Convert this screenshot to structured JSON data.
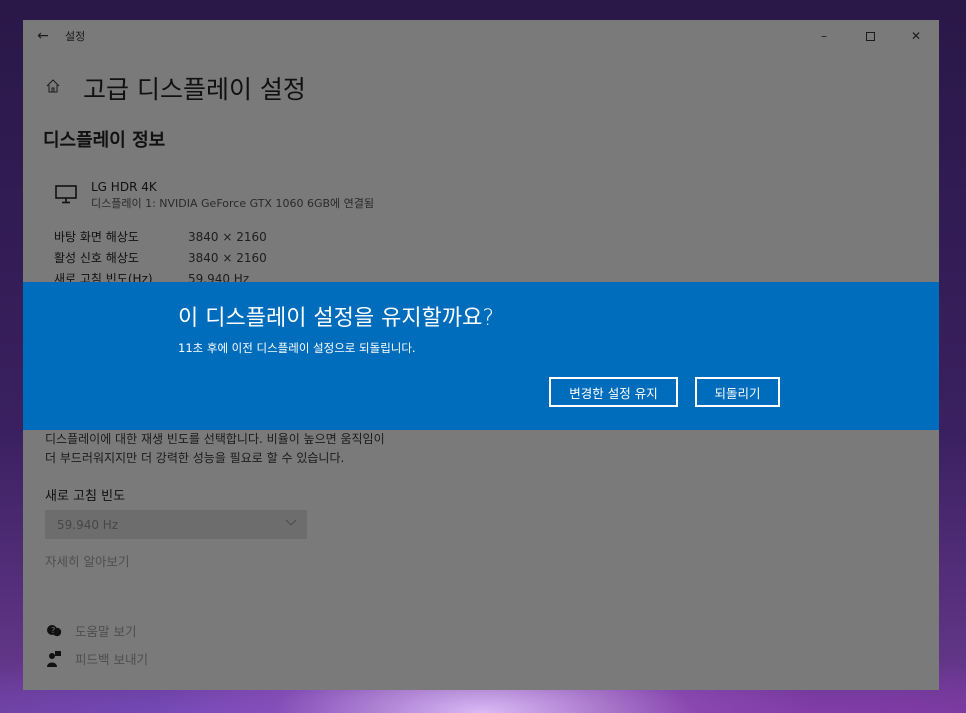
{
  "window": {
    "app_title": "설정",
    "back_glyph": "←",
    "minimize_glyph": "–",
    "close_glyph": "✕"
  },
  "page": {
    "title": "고급 디스플레이 설정",
    "section_title": "디스플레이 정보"
  },
  "monitor": {
    "name": "LG HDR 4K",
    "subtitle": "디스플레이 1: NVIDIA GeForce GTX 1060 6GB에 연결됨",
    "icon": "monitor-icon"
  },
  "info": [
    {
      "label": "바탕 화면 해상도",
      "value": "3840 × 2160"
    },
    {
      "label": "활성 신호 해상도",
      "value": "3840 × 2160"
    },
    {
      "label": "새로 고침 빈도(Hz)",
      "value": "59.940 Hz"
    }
  ],
  "dialog": {
    "title": "이 디스플레이 설정을 유지할까요?",
    "subtitle": "11초 후에 이전 디스플레이 설정으로 되돌립니다.",
    "keep_label": "변경한 설정 유지",
    "revert_label": "되돌리기",
    "background_color": "#006cbc"
  },
  "refresh_rate": {
    "description_line1": "디스플레이에 대한 재생 빈도를 선택합니다. 비율이 높으면 움직임이",
    "description_line2": "더 부드러워지지만 더 강력한 성능을 필요로 할 수 있습니다.",
    "label": "새로 고침 빈도",
    "selected": "59.940 Hz",
    "learn_more": "자세히 알아보기"
  },
  "footer": {
    "help_label": "도움말 보기",
    "feedback_label": "피드백 보내기"
  }
}
